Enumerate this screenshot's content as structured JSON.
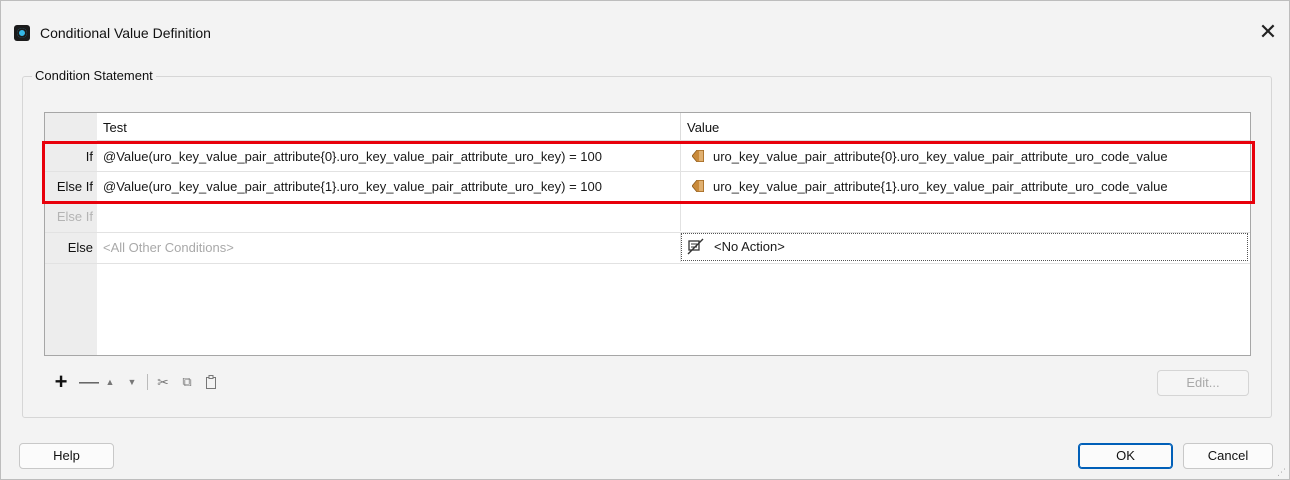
{
  "window": {
    "title": "Conditional Value Definition",
    "close_glyph": "✕"
  },
  "group": {
    "label": "Condition Statement"
  },
  "table": {
    "headers": {
      "row": "",
      "test": "Test",
      "value": "Value"
    },
    "rows": [
      {
        "keyword": "If",
        "test": "@Value(uro_key_value_pair_attribute{0}.uro_key_value_pair_attribute_uro_key) = 100",
        "value": "uro_key_value_pair_attribute{0}.uro_key_value_pair_attribute_uro_code_value",
        "value_icon": "attribute-value-icon"
      },
      {
        "keyword": "Else If",
        "test": "@Value(uro_key_value_pair_attribute{1}.uro_key_value_pair_attribute_uro_key) = 100",
        "value": "uro_key_value_pair_attribute{1}.uro_key_value_pair_attribute_uro_code_value",
        "value_icon": "attribute-value-icon"
      },
      {
        "keyword": "Else If",
        "test": "",
        "value": "",
        "placeholder": true
      },
      {
        "keyword": "Else",
        "test": "<All Other Conditions>",
        "value": "<No Action>",
        "value_icon": "no-action-icon"
      }
    ],
    "highlight_color": "#e8000b"
  },
  "toolbar": {
    "add": "+",
    "remove": "—",
    "move_up": "▲",
    "move_down": "▼",
    "cut": "✂",
    "copy": "⧉",
    "paste": "📋",
    "edit_label": "Edit..."
  },
  "buttons": {
    "help": "Help",
    "ok": "OK",
    "cancel": "Cancel"
  },
  "colors": {
    "accent": "#005fb8",
    "attribute_icon": "#c98a3a"
  }
}
